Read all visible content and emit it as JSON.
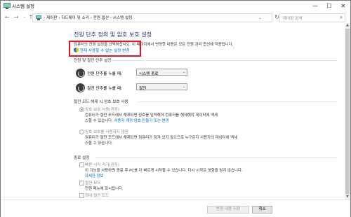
{
  "window": {
    "title": "시스템 설정"
  },
  "nav": {
    "breadcrumbs": "› 제어판 › 하드웨어 및 소리 › 전원 옵션 › 시스템 설정",
    "search_placeholder": "제어판 검색"
  },
  "page": {
    "heading": "전원 단추 정의 및 암호 보호 설정",
    "description": "컴퓨터의 전원 설정을 선택하십시오. 이 페이지에서 변경한 내용은 모든 전원 관리 옵션에 적용됩니다.",
    "change_link": "현재 사용할 수 없는 설정 변경"
  },
  "power_section": {
    "title": "전원 및 절전 단추 설정",
    "rows": [
      {
        "label": "전원 단추를 누를 때:",
        "value": "시스템 종료"
      },
      {
        "label": "절전 단추를 누를 때:",
        "value": "절전"
      }
    ]
  },
  "password_section": {
    "title": "절전 모드 해제 시 암호 보호 사용",
    "options": [
      {
        "label": "암호 보호 사용(권장)",
        "selected": true,
        "desc_line1": "컴퓨터가 절전 모드에서 해제되면 암호를 입력해야 컴퓨터를 해제해야 데이터에 액세",
        "desc_line2": "스할 수 있습니다.",
        "link": "사용자 계정 암호 만들기 또는 변경"
      },
      {
        "label": "암호 보호를 사용하지 않음",
        "selected": false,
        "desc_line1": "컴퓨터가 절전 모드에서 해제되면 컴퓨터가 잠겨 있지 않으므로 누구든지 사용자의 데이터에 액세",
        "desc_line2": "스할 수 있습니다."
      }
    ]
  },
  "shutdown_section": {
    "title": "종료 설정",
    "items": [
      {
        "label": "빠른 시작 켜기(권장)",
        "checked": true,
        "desc": "이 기능을 사용하면 종료 후 PC를 더 빠르게 시작할 수 있습니다. 다시 시작은 영향을 받지 않습니다.",
        "link": "자세한 정보"
      },
      {
        "label": "절전 모드",
        "checked": true,
        "desc": "전원 메뉴에 표시됩니다."
      },
      {
        "label": "최대 절전 모드",
        "checked": false
      }
    ]
  },
  "buttons": {
    "save": "변경 내용 저장",
    "cancel": "취소"
  }
}
